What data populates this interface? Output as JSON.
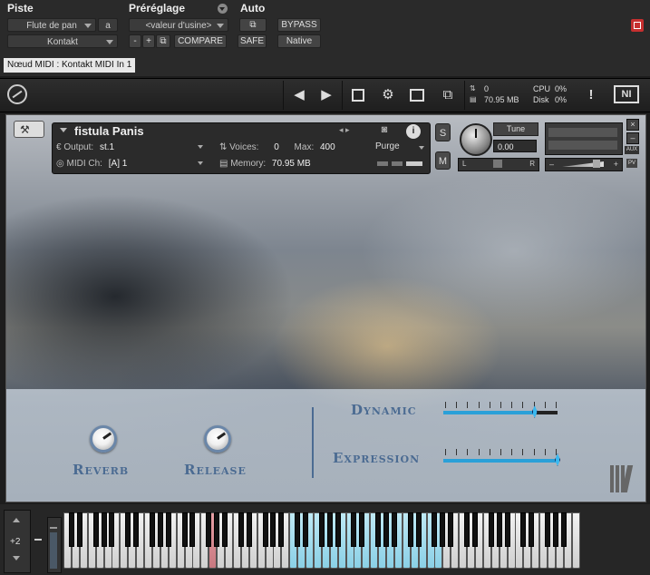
{
  "host": {
    "piste": {
      "heading": "Piste",
      "track_name": "Flute de pan",
      "slot": "a",
      "plugin_name": "Kontakt"
    },
    "preglage": {
      "heading": "Préréglage",
      "preset_value": "<valeur d'usine>",
      "minus": "-",
      "plus": "+",
      "compare": "COMPARE"
    },
    "auto": {
      "heading": "Auto",
      "safe": "SAFE"
    },
    "bypass": "BYPASS",
    "native": "Native",
    "midi_node": "Nœud MIDI : Kontakt MIDI In 1"
  },
  "toolbar": {
    "midi_count": "0",
    "memory": "70.95 MB",
    "cpu_label": "CPU",
    "cpu_value": "0%",
    "disk_label": "Disk",
    "disk_value": "0%",
    "logo": "NI"
  },
  "instrument": {
    "name": "fistula Panis",
    "output_label": "Output:",
    "output_value": "st.1",
    "midi_label": "MIDI Ch:",
    "midi_value": "[A] 1",
    "voices_label": "Voices:",
    "voices_value": "0",
    "max_label": "Max:",
    "max_value": "400",
    "memory_label": "Memory:",
    "memory_value": "70.95 MB",
    "purge_label": "Purge",
    "solo": "S",
    "mute": "M",
    "tune_label": "Tune",
    "tune_value": "0.00",
    "pan_left": "L",
    "pan_right": "R",
    "aux": "AUX",
    "pv": "PV"
  },
  "controls": {
    "reverb_label": "Reverb",
    "release_label": "Release",
    "dynamic_label": "Dynamic",
    "expression_label": "Expression",
    "dynamic_value": 0.8,
    "expression_value": 1.0
  },
  "keyboard": {
    "octave_offset": "+2"
  },
  "colors": {
    "accent": "#2aa0d8",
    "label_blue": "#4b6b92"
  }
}
